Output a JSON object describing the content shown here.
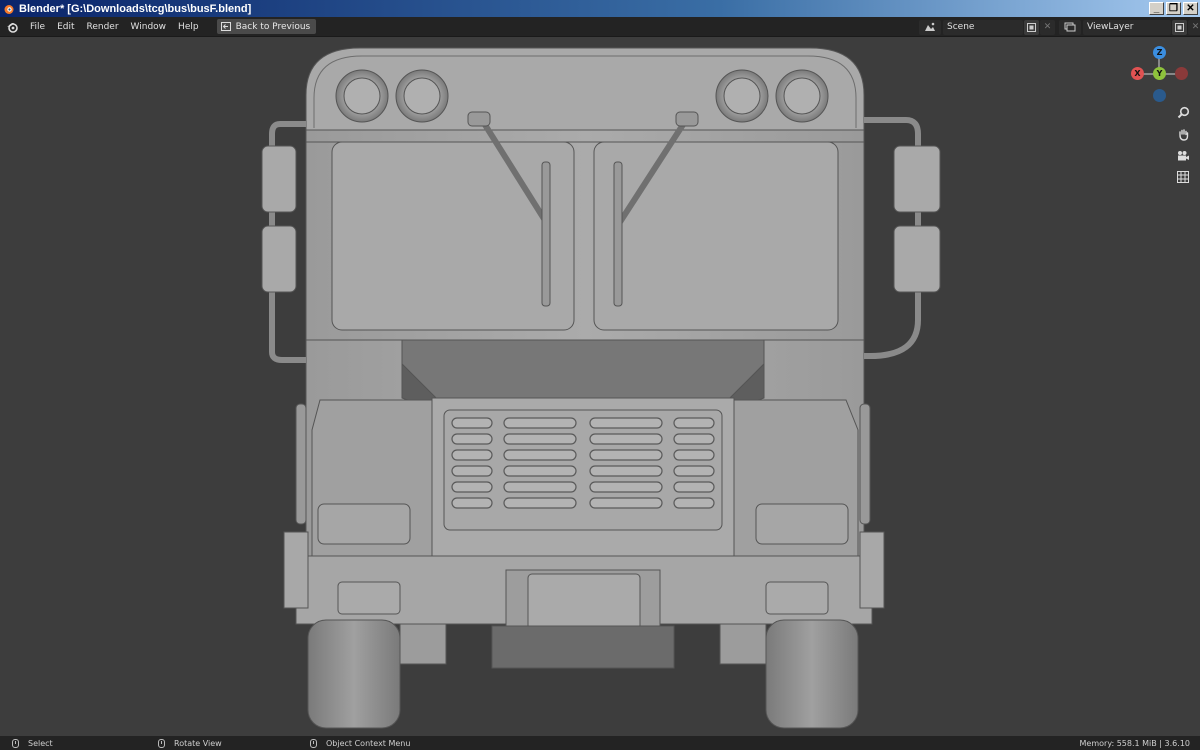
{
  "window": {
    "title": "Blender* [G:\\Downloads\\tcg\\bus\\busF.blend]",
    "controls": {
      "minimize": "_",
      "restore": "❐",
      "close": "✕"
    }
  },
  "topbar": {
    "menu": [
      "File",
      "Edit",
      "Render",
      "Window",
      "Help"
    ],
    "back_button": "Back to Previous",
    "scene_field": "Scene",
    "view_layer_field": "ViewLayer"
  },
  "gizmo": {
    "z": "Z",
    "y": "Y",
    "x": "X"
  },
  "statusbar": {
    "select": "Select",
    "rotate_view": "Rotate View",
    "context_menu": "Object Context Menu",
    "memory": "Memory: 558.1 MiB | 3.6.10"
  },
  "icons": [
    "blender-logo-icon",
    "back-icon",
    "scene-icon",
    "new-icon",
    "close-icon",
    "view-layer-icon",
    "zoom-icon",
    "hand-icon",
    "camera-icon",
    "grid-icon",
    "mouse-icon"
  ],
  "colors": {
    "viewport_bg": "#3d3d3d",
    "header_bg": "#232323",
    "axis_x": "#e05252",
    "axis_y": "#8ec23c",
    "axis_z": "#3b8ee0"
  }
}
